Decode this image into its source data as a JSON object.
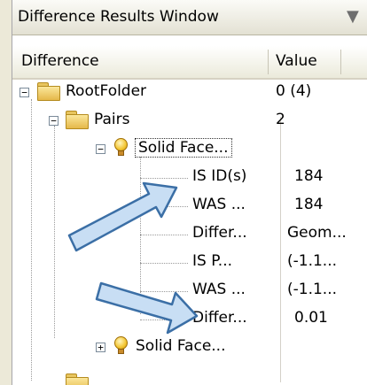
{
  "window": {
    "title": "Difference Results Window"
  },
  "columns": {
    "difference": "Difference",
    "value": "Value"
  },
  "rows": [
    {
      "label": "RootFolder",
      "value": "0 (4)"
    },
    {
      "label": "Pairs",
      "value": "2"
    },
    {
      "label": "Solid Face...",
      "value": ""
    },
    {
      "label": "IS  ID(s)",
      "value": "184"
    },
    {
      "label": "WAS  ...",
      "value": "184"
    },
    {
      "label": "Differ...",
      "value": "Geom..."
    },
    {
      "label": "IS  P...",
      "value": "(-1.1..."
    },
    {
      "label": "WAS  ...",
      "value": "(-1.1..."
    },
    {
      "label": "Differ...",
      "value": "0.01"
    },
    {
      "label": "Solid Face...",
      "value": ""
    }
  ],
  "icons": {
    "collapse": "minus-box-icon",
    "expand": "plus-box-icon",
    "folder": "folder-icon",
    "pair": "bulb-icon",
    "callout": "callout-arrow"
  },
  "colors": {
    "arrow_fill": "#c8def4",
    "arrow_stroke": "#3b6fa6",
    "folder": "#f5d46e"
  }
}
